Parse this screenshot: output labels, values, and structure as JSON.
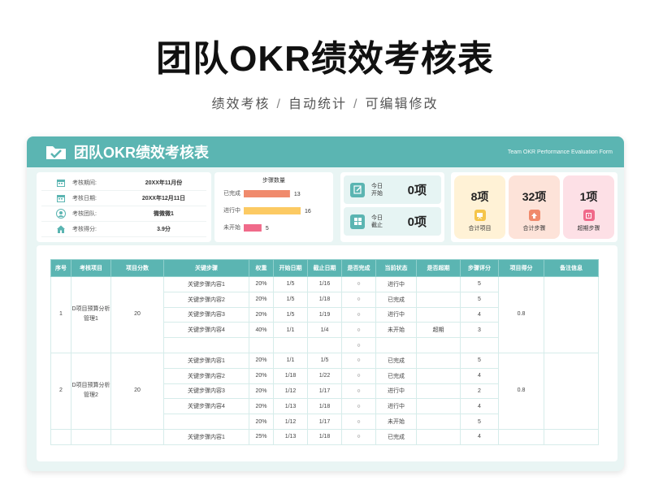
{
  "page": {
    "title": "团队OKR绩效考核表",
    "subtitle_parts": [
      "绩效考核",
      "自动统计",
      "可编辑修改"
    ],
    "separator": "/"
  },
  "sheet": {
    "title": "团队OKR绩效考核表",
    "title_en": "Team OKR Performance Evaluation Form",
    "accent_color": "#5bb5b2"
  },
  "info": [
    {
      "label": "考核期间:",
      "value": "20XX年11月份",
      "icon": "calendar-icon"
    },
    {
      "label": "考核日期:",
      "value": "20XX年12月11日",
      "icon": "calendar-icon"
    },
    {
      "label": "考核团队:",
      "value": "微微微1",
      "icon": "team-icon"
    },
    {
      "label": "考核得分:",
      "value": "3.9分",
      "icon": "home-icon"
    }
  ],
  "chart_data": {
    "type": "bar",
    "orientation": "horizontal",
    "title": "步骤数量",
    "categories": [
      "已完成",
      "进行中",
      "未开始"
    ],
    "values": [
      13,
      16,
      5
    ],
    "colors": [
      "#f08a6c",
      "#fcca63",
      "#f06a8a"
    ],
    "grid": false
  },
  "today": [
    {
      "label": "今日开始",
      "value": "0项",
      "icon": "edit-icon"
    },
    {
      "label": "今日截止",
      "value": "0项",
      "icon": "grid-icon"
    }
  ],
  "stats": [
    {
      "value": "8项",
      "label": "合计项目",
      "bg": "#fff2d6",
      "icon_color": "#f5c54a",
      "icon": "presentation-icon"
    },
    {
      "value": "32项",
      "label": "合计步骤",
      "bg": "#fde3d9",
      "icon_color": "#f08a6c",
      "icon": "upload-icon"
    },
    {
      "value": "1项",
      "label": "超期步骤",
      "bg": "#fde0e6",
      "icon_color": "#f06a8a",
      "icon": "alert-icon"
    }
  ],
  "table": {
    "headers": [
      "序号",
      "考核项目",
      "项目分数",
      "关键步骤",
      "权重",
      "开始日期",
      "截止日期",
      "是否完成",
      "当前状态",
      "是否超期",
      "步骤评分",
      "项目得分",
      "备注信息"
    ],
    "groups": [
      {
        "no": "1",
        "project": "D项目预算分析管理1",
        "score": "20",
        "result": "0.8",
        "rows": [
          {
            "step": "关键步骤内容1",
            "weight": "20%",
            "start": "1/5",
            "end": "1/16",
            "done": "○",
            "status": "进行中",
            "overdue": "",
            "rating": "5"
          },
          {
            "step": "关键步骤内容2",
            "weight": "20%",
            "start": "1/5",
            "end": "1/18",
            "done": "○",
            "status": "已完成",
            "overdue": "",
            "rating": "5"
          },
          {
            "step": "关键步骤内容3",
            "weight": "20%",
            "start": "1/5",
            "end": "1/19",
            "done": "○",
            "status": "进行中",
            "overdue": "",
            "rating": "4"
          },
          {
            "step": "关键步骤内容4",
            "weight": "40%",
            "start": "1/1",
            "end": "1/4",
            "done": "○",
            "status": "未开始",
            "overdue": "超期",
            "rating": "3"
          },
          {
            "step": "",
            "weight": "",
            "start": "",
            "end": "",
            "done": "○",
            "status": "",
            "overdue": "",
            "rating": ""
          }
        ]
      },
      {
        "no": "2",
        "project": "D项目预算分析管理2",
        "score": "20",
        "result": "0.8",
        "rows": [
          {
            "step": "关键步骤内容1",
            "weight": "20%",
            "start": "1/1",
            "end": "1/5",
            "done": "○",
            "status": "已完成",
            "overdue": "",
            "rating": "5"
          },
          {
            "step": "关键步骤内容2",
            "weight": "20%",
            "start": "1/18",
            "end": "1/22",
            "done": "○",
            "status": "已完成",
            "overdue": "",
            "rating": "4"
          },
          {
            "step": "关键步骤内容3",
            "weight": "20%",
            "start": "1/12",
            "end": "1/17",
            "done": "○",
            "status": "进行中",
            "overdue": "",
            "rating": "2"
          },
          {
            "step": "关键步骤内容4",
            "weight": "20%",
            "start": "1/13",
            "end": "1/18",
            "done": "○",
            "status": "进行中",
            "overdue": "",
            "rating": "4"
          },
          {
            "step": "",
            "weight": "20%",
            "start": "1/12",
            "end": "1/17",
            "done": "○",
            "status": "未开始",
            "overdue": "",
            "rating": "5"
          }
        ]
      },
      {
        "no": "",
        "project": "",
        "score": "",
        "result": "",
        "rows": [
          {
            "step": "关键步骤内容1",
            "weight": "25%",
            "start": "1/13",
            "end": "1/18",
            "done": "○",
            "status": "已完成",
            "overdue": "",
            "rating": "4"
          }
        ]
      }
    ]
  }
}
